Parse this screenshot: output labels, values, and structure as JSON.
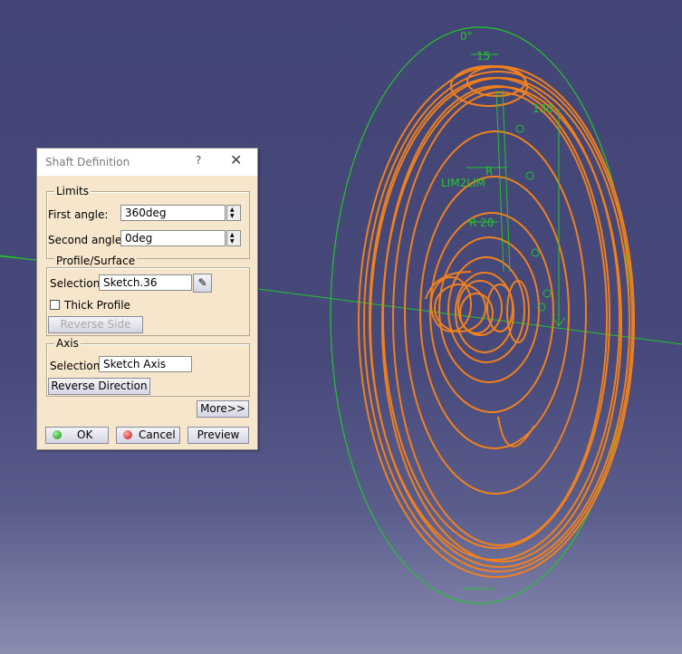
{
  "viewport": {
    "annotations": [
      "0°",
      "15",
      "130",
      "LIM2LIM",
      "R",
      "20",
      "R"
    ],
    "colors": {
      "geometry": "#f0801e",
      "constraints": "#22c62a",
      "background": "#424576"
    }
  },
  "dialog": {
    "title": "Shaft Definition",
    "help": "?",
    "close": "✕",
    "limits": {
      "legend": "Limits",
      "first_angle_label": "First angle:",
      "first_angle_value": "360deg",
      "second_angle_label": "Second angle:",
      "second_angle_value": "0deg"
    },
    "profile": {
      "legend": "Profile/Surface",
      "selection_label": "Selection:",
      "selection_value": "Sketch.36",
      "thick_profile_label": "Thick Profile",
      "thick_profile_checked": false,
      "reverse_side_label": "Reverse Side"
    },
    "axis": {
      "legend": "Axis",
      "selection_label": "Selection:",
      "selection_value": "Sketch Axis",
      "reverse_direction_label": "Reverse Direction"
    },
    "more_label": "More>>",
    "ok_label": "OK",
    "cancel_label": "Cancel",
    "preview_label": "Preview"
  }
}
